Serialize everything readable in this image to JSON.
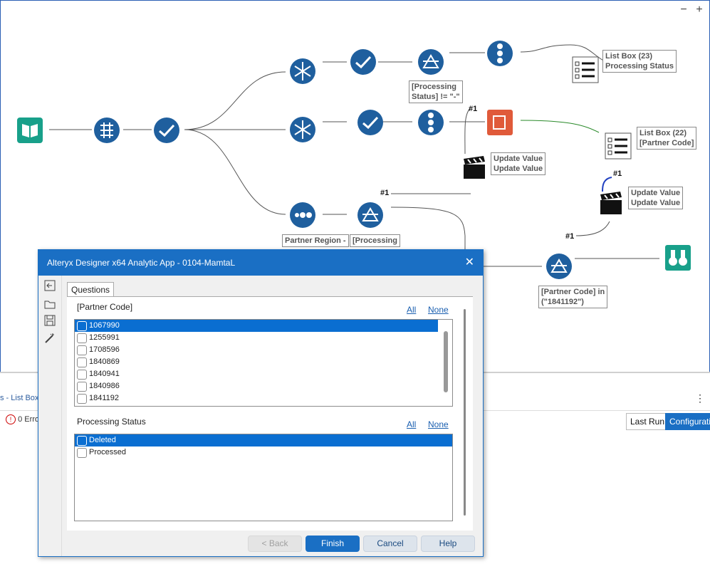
{
  "canvas": {
    "zoom_out": "−",
    "zoom_in": "+",
    "labels": {
      "filter_top": "[Processing\nStatus] != \"-\"",
      "listbox_23": "List Box (23)\nProcessing Status",
      "listbox_22": "List Box (22)\n[Partner Code]",
      "update_1": "Update Value\nUpdate Value",
      "update_2": "Update Value\nUpdate Value",
      "partner_region": "Partner Region -",
      "filter_mid": "[Processing",
      "filter_bottom": "[Partner Code] in\n(\"1841192\")"
    },
    "hash_marks": [
      "#1",
      "#1",
      "#1",
      "#1"
    ]
  },
  "bottom_pane": {
    "tab_label": "s - List Box",
    "errors": "0 Erro",
    "last_run": "Last Run",
    "configuration": "Configurati",
    "menu_icon": "⋮"
  },
  "dialog": {
    "title": "Alteryx Designer x64 Analytic App - 0104-MamtaL",
    "close": "✕",
    "tab": "Questions",
    "side_icons": [
      "back-icon",
      "folder-icon",
      "save-icon",
      "wand-icon"
    ],
    "q1": {
      "title": "[Partner Code]",
      "all": "All",
      "none": "None",
      "items": [
        "1067990",
        "1255991",
        "1708596",
        "1840869",
        "1840941",
        "1840986",
        "1841192"
      ]
    },
    "q2": {
      "title": "Processing Status",
      "all": "All",
      "none": "None",
      "items": [
        "Deleted",
        "Processed"
      ]
    },
    "buttons": {
      "back": "< Back",
      "finish": "Finish",
      "cancel": "Cancel",
      "help": "Help"
    }
  }
}
